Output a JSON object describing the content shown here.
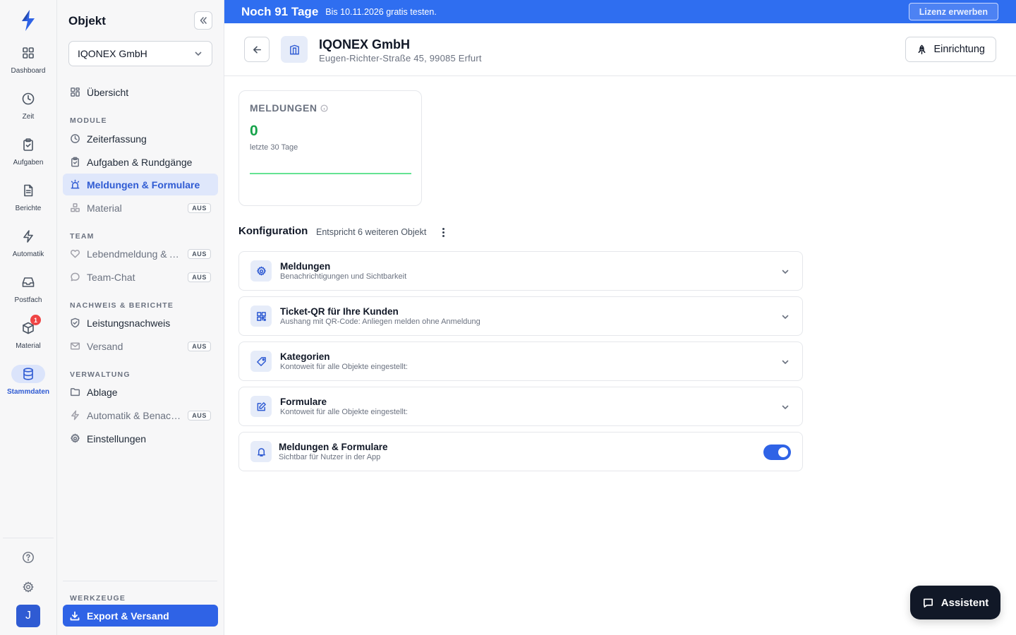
{
  "rail": {
    "items": [
      {
        "label": "Dashboard",
        "icon": "grid-icon"
      },
      {
        "label": "Zeit",
        "icon": "clock-icon"
      },
      {
        "label": "Aufgaben",
        "icon": "clipboard-icon"
      },
      {
        "label": "Berichte",
        "icon": "document-icon"
      },
      {
        "label": "Automatik",
        "icon": "bolt-icon"
      },
      {
        "label": "Postfach",
        "icon": "inbox-icon"
      },
      {
        "label": "Material",
        "icon": "box-icon",
        "badge": "1"
      },
      {
        "label": "Stammdaten",
        "icon": "database-icon",
        "active": true
      }
    ],
    "avatar": "J"
  },
  "sidebar": {
    "title": "Objekt",
    "selected_object": "IQONEX GmbH",
    "overview": "Übersicht",
    "sections": {
      "module": "MODULE",
      "team": "TEAM",
      "nachweis": "NACHWEIS & BERICHTE",
      "verwaltung": "VERWALTUNG",
      "werkzeuge": "WERKZEUGE"
    },
    "items": {
      "zeiterfassung": "Zeiterfassung",
      "aufgaben": "Aufgaben & Rundgänge",
      "meldungen": "Meldungen & Formulare",
      "material": "Material",
      "lebendmeldung": "Lebendmeldung & Alleinarbeit",
      "teamchat": "Team-Chat",
      "leistungsnachweis": "Leistungsnachweis",
      "versand": "Versand",
      "ablage": "Ablage",
      "automatik": "Automatik & Benachrichtigungen",
      "einstellungen": "Einstellungen"
    },
    "off_badge": "AUS",
    "export": "Export & Versand"
  },
  "banner": {
    "days": "Noch 91 Tage",
    "text": "Bis 10.11.2026 gratis testen.",
    "license_button": "Lizenz erwerben"
  },
  "header": {
    "name": "IQONEX GmbH",
    "address": "Eugen-Richter-Straße 45, 99085 Erfurt",
    "setup_button": "Einrichtung"
  },
  "stat": {
    "title": "MELDUNGEN",
    "value": "0",
    "period": "letzte 30 Tage"
  },
  "config": {
    "title": "Konfiguration",
    "subtitle": "Entspricht 6 weiteren Objekt",
    "rows": [
      {
        "title": "Meldungen",
        "subtitle": "Benachrichtigungen und Sichtbarkeit",
        "icon": "gear-icon"
      },
      {
        "title": "Ticket-QR für Ihre Kunden",
        "subtitle": "Aushang mit QR-Code: Anliegen melden ohne Anmeldung",
        "icon": "qr-code-icon"
      },
      {
        "title": "Kategorien",
        "subtitle": "Kontoweit für alle Objekte eingestellt:",
        "icon": "tag-icon"
      },
      {
        "title": "Formulare",
        "subtitle": "Kontoweit für alle Objekte eingestellt:",
        "icon": "edit-icon"
      }
    ],
    "toggle_row": {
      "title": "Meldungen & Formulare",
      "subtitle": "Sichtbar für Nutzer in der App",
      "enabled": true,
      "icon": "bell-icon"
    }
  },
  "assistant": "Assistent",
  "colors": {
    "accent": "#2f63e6",
    "banner": "#2f6ef0",
    "stat_value": "#16a34a"
  }
}
